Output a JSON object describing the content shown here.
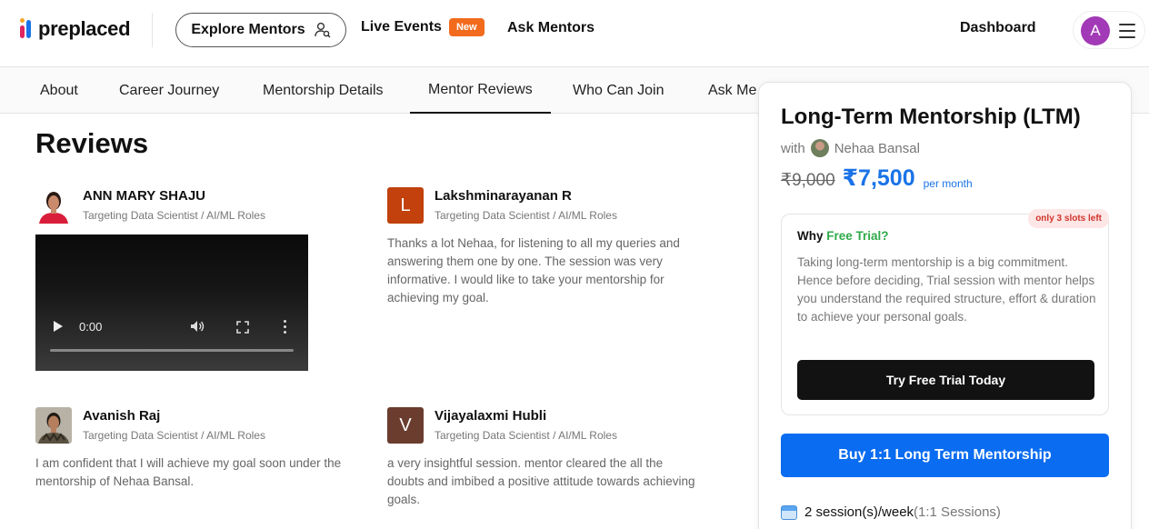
{
  "header": {
    "logo_text": "preplaced",
    "explore_label": "Explore Mentors",
    "live_events_label": "Live Events",
    "new_badge": "New",
    "ask_mentors_label": "Ask Mentors",
    "dashboard_label": "Dashboard",
    "avatar_letter": "A"
  },
  "subnav": {
    "tabs": [
      {
        "label": "About"
      },
      {
        "label": "Career Journey"
      },
      {
        "label": "Mentorship Details"
      },
      {
        "label": "Mentor Reviews"
      },
      {
        "label": "Who Can Join"
      },
      {
        "label": "Ask Me"
      }
    ],
    "active": "Mentor Reviews"
  },
  "reviews": {
    "title": "Reviews",
    "items": [
      {
        "name": "ANN MARY SHAJU",
        "role": "Targeting Data Scientist / AI/ML Roles",
        "text": "",
        "avatar": "photo"
      },
      {
        "name": "Lakshminarayanan R",
        "role": "Targeting Data Scientist / AI/ML Roles",
        "text": "Thanks a lot Nehaa, for listening to all my queries and answering them one by one. The session was very informative. I would like to take your mentorship for achieving my goal.",
        "avatar_letter": "L",
        "avatar_color": "#c2410c"
      },
      {
        "name": "Avanish Raj",
        "role": "Targeting Data Scientist / AI/ML Roles",
        "text": "I am confident that I will achieve my goal soon under the mentorship of Nehaa Bansal.",
        "avatar": "photo"
      },
      {
        "name": "Vijayalaxmi Hubli",
        "role": "Targeting Data Scientist / AI/ML Roles",
        "text": "a very insightful session. mentor cleared the all the doubts and imbibed a positive attitude towards achieving goals.",
        "avatar_letter": "V",
        "avatar_color": "#6b3d2e"
      }
    ],
    "video": {
      "time": "0:00"
    }
  },
  "card": {
    "title": "Long-Term Mentorship (LTM)",
    "with_label": "with",
    "mentor_name": "Nehaa Bansal",
    "old_price": "₹9,000",
    "new_price": "₹7,500",
    "per_month": "per month",
    "slots_badge": "only 3 slots left",
    "why_label": "Why",
    "free_trial_label": "Free Trial?",
    "trial_desc": "Taking long-term mentorship is a big commitment. Hence before deciding, Trial session with mentor helps you understand the required structure, effort & duration to achieve your personal goals.",
    "trial_button": "Try Free Trial Today",
    "buy_button": "Buy 1:1 Long Term Mentorship",
    "sessions_text": "2 session(s)/week",
    "sessions_note": "(1:1 Sessions)"
  },
  "colors": {
    "accent_blue": "#0a6cf0",
    "price_blue": "#1a73e8",
    "badge_orange": "#f26b1d",
    "trial_green": "#2eaa4a",
    "avatar_purple": "#a239b6"
  }
}
